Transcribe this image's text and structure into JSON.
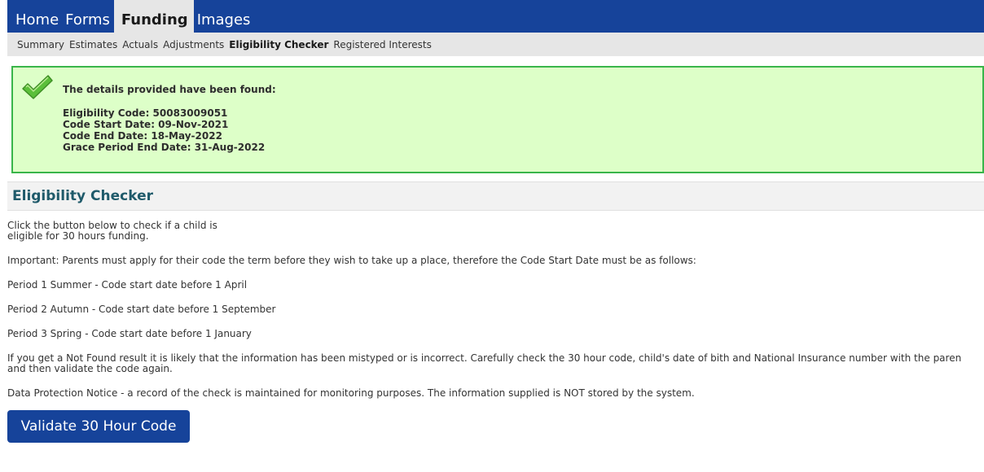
{
  "topnav": {
    "items": [
      "Home",
      "Forms",
      "Funding",
      "Images"
    ],
    "active": "Funding"
  },
  "subnav": {
    "items": [
      "Summary",
      "Estimates",
      "Actuals",
      "Adjustments",
      "Eligibility Checker",
      "Registered Interests"
    ],
    "active": "Eligibility Checker"
  },
  "success": {
    "title": "The details provided have been found:",
    "lines": [
      "Eligibility Code: 50083009051",
      "Code Start Date: 09-Nov-2021",
      "Code End Date: 18-May-2022",
      "Grace Period End Date: 31-Aug-2022"
    ]
  },
  "section": {
    "heading": "Eligibility Checker"
  },
  "content": {
    "intro": "Click the button below to check if a child is eligible for 30 hours funding.",
    "important": "Important: Parents must apply for their code the term before they wish to take up a place, therefore the Code Start Date must be as follows:",
    "period1": "Period 1 Summer - Code start date before 1 April",
    "period2": "Period 2 Autumn - Code start date before 1 September",
    "period3": "Period 3 Spring - Code start date before 1 January",
    "notfound_line1": "If you get a Not Found result it is likely that the information has been mistyped or is incorrect. Carefully check the 30 hour code, child's date of bith and National Insurance number with the paren",
    "notfound_line2": "and then validate the code again.",
    "data_protection": "Data Protection Notice - a record of the check is maintained for monitoring purposes. The information supplied is NOT stored by the system."
  },
  "actions": {
    "validate_label": "Validate 30 Hour Code"
  },
  "colors": {
    "nav_blue": "#16439a",
    "success_bg": "#ddffc8",
    "success_border": "#39b54a",
    "heading_teal": "#1f5a6a"
  }
}
